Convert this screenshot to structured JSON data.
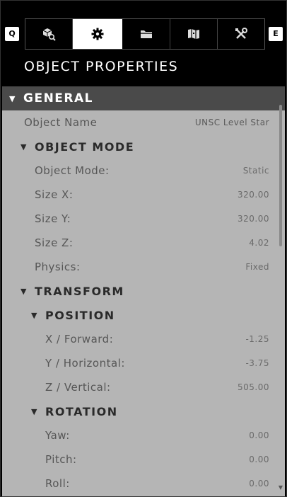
{
  "keys": {
    "left": "Q",
    "right": "E"
  },
  "tabs": [
    {
      "icon": "object-browser-icon",
      "active": false
    },
    {
      "icon": "gear-icon",
      "active": true
    },
    {
      "icon": "folder-icon",
      "active": false
    },
    {
      "icon": "map-icon",
      "active": false
    },
    {
      "icon": "tools-icon",
      "active": false
    }
  ],
  "panel_title": "OBJECT PROPERTIES",
  "general": {
    "header": "GENERAL",
    "object_name_label": "Object Name",
    "object_name_value": "UNSC Level Star"
  },
  "object_mode": {
    "header": "OBJECT MODE",
    "rows": [
      {
        "label": "Object Mode:",
        "value": "Static"
      },
      {
        "label": "Size X:",
        "value": "320.00"
      },
      {
        "label": "Size Y:",
        "value": "320.00"
      },
      {
        "label": "Size Z:",
        "value": "4.02"
      },
      {
        "label": "Physics:",
        "value": "Fixed"
      }
    ]
  },
  "transform": {
    "header": "TRANSFORM",
    "position": {
      "header": "POSITION",
      "rows": [
        {
          "label": "X / Forward:",
          "value": "-1.25"
        },
        {
          "label": "Y / Horizontal:",
          "value": "-3.75"
        },
        {
          "label": "Z / Vertical:",
          "value": "505.00"
        }
      ]
    },
    "rotation": {
      "header": "ROTATION",
      "rows": [
        {
          "label": "Yaw:",
          "value": "0.00"
        },
        {
          "label": "Pitch:",
          "value": "0.00"
        },
        {
          "label": "Roll:",
          "value": "0.00"
        }
      ]
    }
  }
}
